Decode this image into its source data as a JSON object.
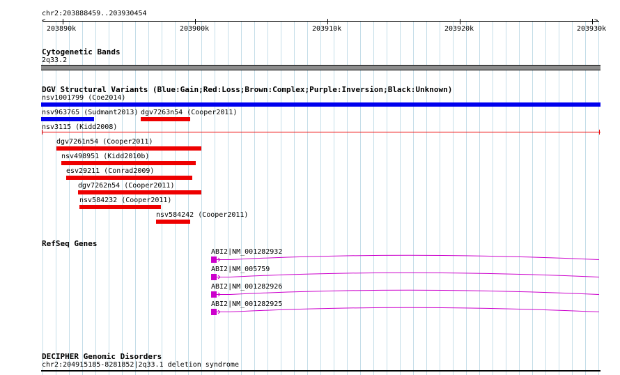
{
  "coords": "chr2:203888459..203930454",
  "axis": {
    "ticks": [
      "203890k",
      "203900k",
      "203910k",
      "203920k",
      "203930k"
    ]
  },
  "cytoband": {
    "title": "Cytogenetic Bands",
    "band": "2q33.2"
  },
  "dgv": {
    "title": "DGV Structural Variants (Blue:Gain;Red:Loss;Brown:Complex;Purple:Inversion;Black:Unknown)",
    "colors": {
      "gain": "#0000ee",
      "loss": "#ee0000"
    },
    "variants": [
      {
        "label": "nsv1001799 (Coe2014)",
        "type": "gain"
      },
      {
        "label": "nsv963765 (Sudmant2013)",
        "type": "gain"
      },
      {
        "label": "dgv7263n54 (Cooper2011)",
        "type": "loss"
      },
      {
        "label": "nsv3115 (Kidd2008)",
        "type": "loss"
      },
      {
        "label": "dgv7261n54 (Cooper2011)",
        "type": "loss"
      },
      {
        "label": "nsv498951 (Kidd2010b)",
        "type": "loss"
      },
      {
        "label": "esv29211 (Conrad2009)",
        "type": "loss"
      },
      {
        "label": "dgv7262n54 (Cooper2011)",
        "type": "loss"
      },
      {
        "label": "nsv584232 (Cooper2011)",
        "type": "loss"
      },
      {
        "label": "nsv584242 (Cooper2011)",
        "type": "loss"
      }
    ]
  },
  "refseq": {
    "title": "RefSeq Genes",
    "color": "#cc00cc",
    "genes": [
      {
        "label": "ABI2|NM_001282932"
      },
      {
        "label": "ABI2|NM_005759"
      },
      {
        "label": "ABI2|NM_001282926"
      },
      {
        "label": "ABI2|NM_001282925"
      }
    ]
  },
  "decipher": {
    "title": "DECIPHER Genomic Disorders",
    "entry": "chr2:204915185-8281852|2q33.1 deletion syndrome"
  }
}
